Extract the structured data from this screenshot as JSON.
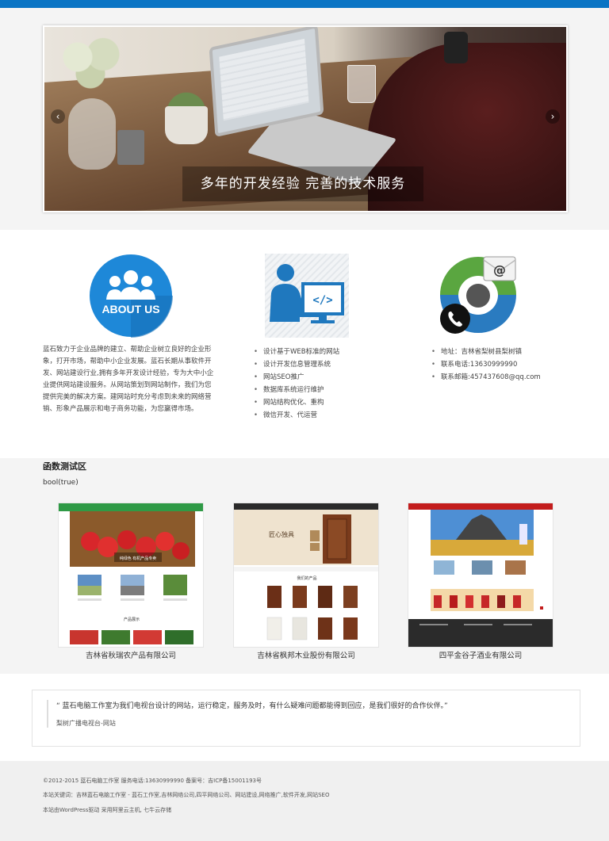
{
  "slider": {
    "caption": "多年的开发经验 完善的技术服务",
    "prev_label": "‹",
    "next_label": "›"
  },
  "features": {
    "about": {
      "icon_label": "ABOUT US",
      "text": "蓝石致力于企业品牌的建立、帮助企业树立良好的企业形象，打开市场，帮助中小企业发展。蓝石长期从事软件开发、网站建设行业,拥有多年开发设计经验，专为大中小企业提供网站建设服务。从网站策划到网站制作，我们为您提供完美的解决方案。建网站时充分考虑到未来的网络营销、形象产品展示和电子商务功能，为您赢得市场。"
    },
    "services": [
      "设计基于WEB标准的网站",
      "设计开发信息管理系统",
      "网站SEO推广",
      "数据库系统运行维护",
      "网站结构优化、重构",
      "微信开发、代运营"
    ],
    "contact": [
      "地址：吉林省梨树县梨树镇",
      "联系电话:13630999990",
      "联系邮箱:457437608@qq.com"
    ]
  },
  "cases": {
    "title": "函数测试区",
    "subtitle": "bool(true)",
    "items": [
      {
        "label": "吉林省秋瑞农产品有限公司",
        "thumb_heading": "产品展示",
        "thumb_banner": "纯绿色 有机产品专卖"
      },
      {
        "label": "吉林省枫邦木业股份有限公司",
        "thumb_heading": "我们的产品",
        "thumb_banner": "匠心独具"
      },
      {
        "label": "四平金谷子酒业有限公司"
      }
    ]
  },
  "testimonial": {
    "text": "“ 蓝石电脑工作室为我们电视台设计的网站，运行稳定，服务及时，有什么疑难问题都能得到回应，是我们很好的合作伙伴。”",
    "author": "梨树广播电视台-网站"
  },
  "footer": {
    "line1": "©2012-2015 蓝石电脑工作室 服务电话:13630999990 备案号：吉ICP备15001193号",
    "line2": "本站关键词：吉林蓝石电脑工作室 - 蓝石工作室,吉林网络公司,四平网络公司、网站建设,网络推广,软件开发,网站SEO",
    "line3": "本站由WordPress驱动 采用阿里云主机, 七牛云存储"
  },
  "colors": {
    "topbar": "#0a74c4",
    "about_circle": "#1e88d8",
    "service_blue": "#1f78be",
    "contact_green": "#5aa640",
    "contact_blue": "#2a7bc0"
  }
}
